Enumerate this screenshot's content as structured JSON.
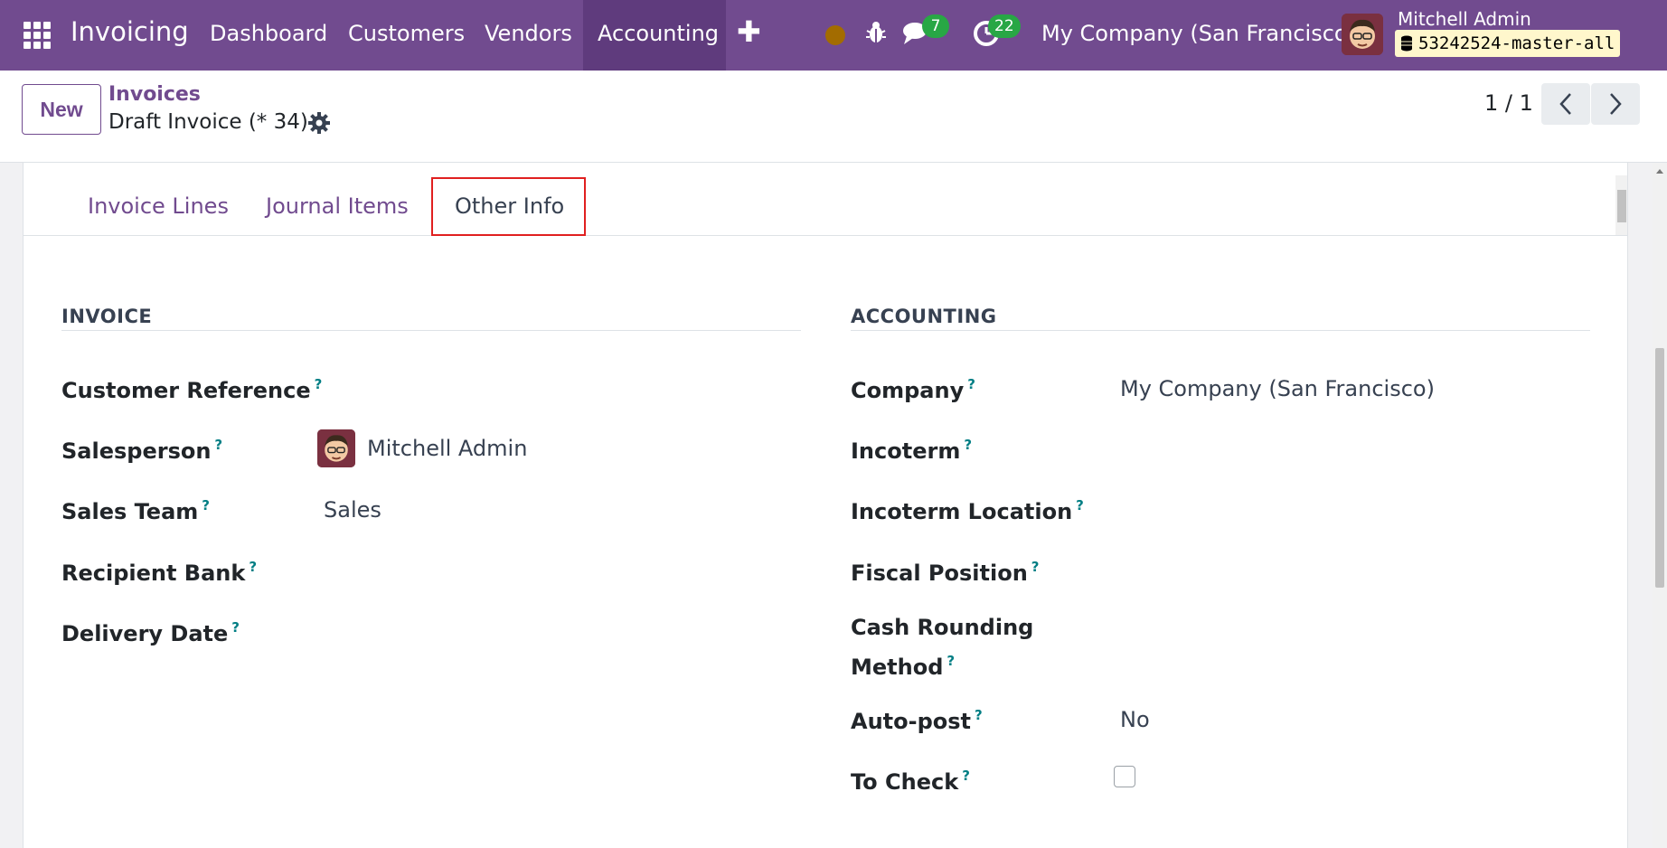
{
  "navbar": {
    "app_name": "Invoicing",
    "menu": [
      "Dashboard",
      "Customers",
      "Vendors",
      "Accounting"
    ],
    "active_menu": "Accounting",
    "messages_count": "7",
    "activities_count": "22",
    "company": "My Company (San Francisco)",
    "user_name": "Mitchell Admin",
    "database": "53242524-master-all"
  },
  "control": {
    "new_label": "New",
    "breadcrumb_parent": "Invoices",
    "breadcrumb_current": "Draft Invoice (* 34)",
    "pager": "1 / 1"
  },
  "tabs": {
    "invoice_lines": "Invoice Lines",
    "journal_items": "Journal Items",
    "other_info": "Other Info"
  },
  "invoice_section": {
    "title": "INVOICE",
    "customer_reference": "Customer Reference",
    "salesperson": "Salesperson",
    "salesperson_value": "Mitchell Admin",
    "sales_team": "Sales Team",
    "sales_team_value": "Sales",
    "recipient_bank": "Recipient Bank",
    "delivery_date": "Delivery Date"
  },
  "accounting_section": {
    "title": "ACCOUNTING",
    "company": "Company",
    "company_value": "My Company (San Francisco)",
    "incoterm": "Incoterm",
    "incoterm_location": "Incoterm Location",
    "fiscal_position": "Fiscal Position",
    "cash_rounding_1": "Cash Rounding",
    "cash_rounding_2": "Method",
    "auto_post": "Auto-post",
    "auto_post_value": "No",
    "to_check": "To Check"
  },
  "help_mark": "?",
  "colors": {
    "brand": "#714b8f",
    "help": "#017e84",
    "badge": "#28a745",
    "highlight": "#e02020"
  }
}
